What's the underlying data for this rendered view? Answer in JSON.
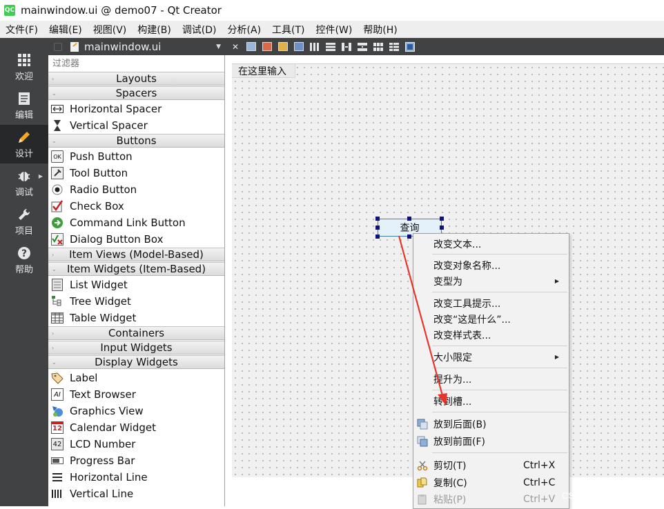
{
  "window": {
    "title": "mainwindow.ui @ demo07 - Qt Creator",
    "logo_text": "QC"
  },
  "menubar": [
    "文件(F)",
    "编辑(E)",
    "视图(V)",
    "构建(B)",
    "调试(D)",
    "分析(A)",
    "工具(T)",
    "控件(W)",
    "帮助(H)"
  ],
  "modes": [
    {
      "label": "欢迎",
      "icon": "grid-icon",
      "active": false
    },
    {
      "label": "编辑",
      "icon": "document-icon",
      "active": false
    },
    {
      "label": "设计",
      "icon": "pencil-icon",
      "active": true
    },
    {
      "label": "调试",
      "icon": "bug-icon",
      "active": false
    },
    {
      "label": "项目",
      "icon": "wrench-icon",
      "active": false
    },
    {
      "label": "帮助",
      "icon": "help-icon",
      "active": false
    }
  ],
  "editor": {
    "file_name": "mainwindow.ui",
    "close_glyph": "✕"
  },
  "widget_box": {
    "filter_placeholder": "过滤器",
    "categories": {
      "layouts": "Layouts",
      "spacers": "Spacers",
      "buttons": "Buttons",
      "item_views": "Item Views (Model-Based)",
      "item_widgets": "Item Widgets (Item-Based)",
      "containers": "Containers",
      "input_widgets": "Input Widgets",
      "display_widgets": "Display Widgets"
    },
    "items": {
      "horizontal_spacer": "Horizontal Spacer",
      "vertical_spacer": "Vertical Spacer",
      "push_button": "Push Button",
      "tool_button": "Tool Button",
      "radio_button": "Radio Button",
      "check_box": "Check Box",
      "command_link_button": "Command Link Button",
      "dialog_button_box": "Dialog Button Box",
      "list_widget": "List Widget",
      "tree_widget": "Tree Widget",
      "table_widget": "Table Widget",
      "label": "Label",
      "text_browser": "Text Browser",
      "graphics_view": "Graphics View",
      "calendar_widget": "Calendar Widget",
      "lcd_number": "LCD Number",
      "progress_bar": "Progress Bar",
      "horizontal_line": "Horizontal Line",
      "vertical_line": "Vertical Line"
    },
    "icon_text": {
      "push_button": "OK",
      "calendar_day": "12",
      "lcd": "42",
      "text_browser": "AI"
    }
  },
  "form": {
    "menu_placeholder": "在这里输入",
    "selected_button_label": "查询"
  },
  "context_menu": {
    "change_text": "改变文本...",
    "change_object_name": "改变对象名称...",
    "morph_into": "变型为",
    "change_tooltip": "改变工具提示...",
    "change_whats_this": "改变“这是什么”...",
    "change_stylesheet": "改变样式表...",
    "size_constraints": "大小限定",
    "promote_to": "提升为...",
    "go_to_slot": "转到槽...",
    "send_to_back": "放到后面(B)",
    "bring_to_front": "放到前面(F)",
    "cut": "剪切(T)",
    "cut_shortcut": "Ctrl+X",
    "copy": "复制(C)",
    "copy_shortcut": "Ctrl+C",
    "paste": "粘贴(P)",
    "paste_shortcut": "Ctrl+V"
  },
  "watermark": "CSDN @刘鑫磊up",
  "colors": {
    "annotation_arrow": "#e8352b",
    "selection_handle": "#101080",
    "active_mode": "#262829"
  }
}
